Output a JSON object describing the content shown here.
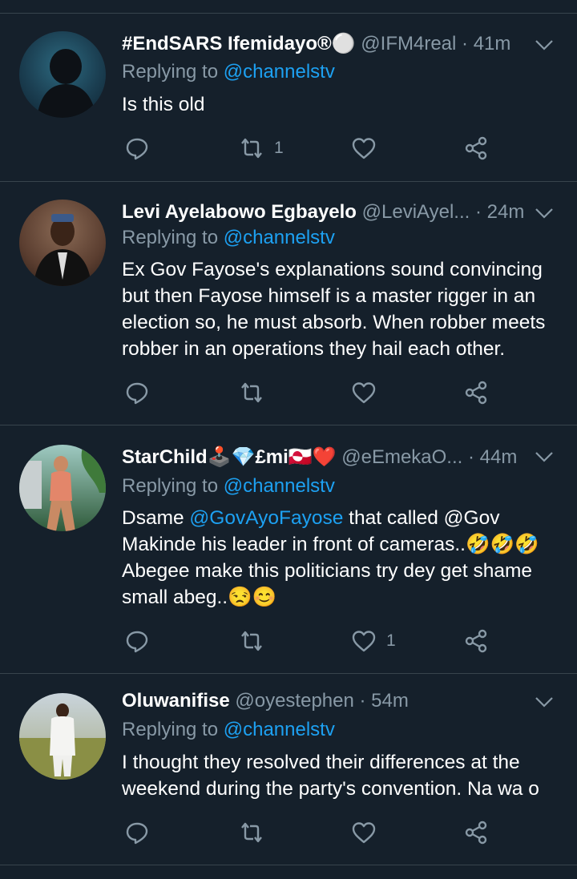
{
  "tweets": [
    {
      "name": "#EndSARS Ifemidayo®⚪",
      "handle": "@IFM4real",
      "time": "· 41m",
      "replying_prefix": "Replying to",
      "replying_to": "@channelstv",
      "text_lines": [
        "Is this old"
      ],
      "retweets": "1",
      "likes": ""
    },
    {
      "name": "Levi Ayelabowo Egbayelo",
      "handle": "@LeviAyel...",
      "time": "· 24m",
      "replying_prefix": "Replying to",
      "replying_to": "@channelstv",
      "text_lines": [
        "Ex Gov Fayose's explanations sound convincing",
        "but then Fayose himself is a master rigger in an",
        "election so, he must absorb. When robber meets",
        "robber in an operations they hail each other."
      ],
      "retweets": "",
      "likes": ""
    },
    {
      "name": "StarChild🕹️💎£mi🇬🇱❤️",
      "handle": "@eEmekaO...",
      "time": "· 44m",
      "replying_prefix": "Replying to",
      "replying_to": "@channelstv",
      "line1_prefix": "Dsame ",
      "line1_mention": "@GovAyoFayose",
      "line1_suffix": "  that called @Gov",
      "line2": "Makinde his leader in front of cameras..🤣🤣🤣",
      "line3": "Abegee make this politicians try dey get shame",
      "line4": "small abeg..😒😊",
      "retweets": "",
      "likes": "1"
    },
    {
      "name": "Oluwanifise",
      "handle": "@oyestephen",
      "time": "· 54m",
      "replying_prefix": "Replying to",
      "replying_to": "@channelstv",
      "text_lines": [
        "I thought they resolved their differences at the",
        "weekend during the party's convention.  Na wa o"
      ],
      "retweets": "",
      "likes": ""
    }
  ],
  "icons": {
    "reply": "reply-icon",
    "retweet": "retweet-icon",
    "like": "heart-icon",
    "share": "share-icon",
    "caret": "chevron-down-icon"
  },
  "colors": {
    "background": "#15202b",
    "divider": "#38444d",
    "secondary_text": "#8899a6",
    "link": "#1da1f2"
  }
}
